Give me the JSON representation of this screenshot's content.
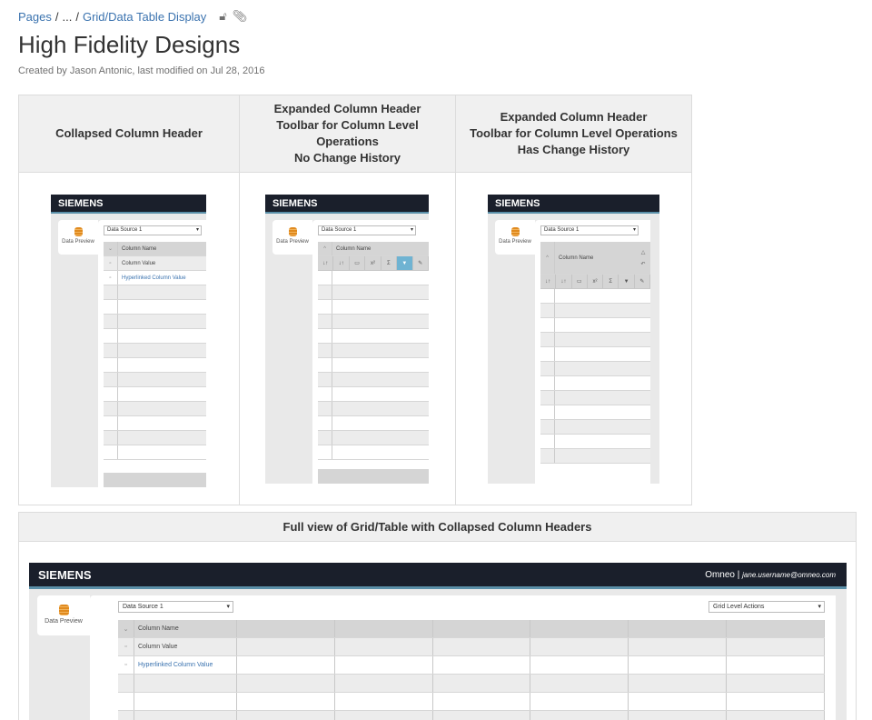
{
  "breadcrumb": {
    "pages": "Pages",
    "sep1": "/",
    "ellipsis": "...",
    "sep2": "/",
    "current": "Grid/Data Table Display"
  },
  "title": "High Fidelity Designs",
  "byline": "Created by Jason Antonic, last modified on Jul 28, 2016",
  "comparison": {
    "headers": [
      "Collapsed Column Header",
      "Expanded Column Header\nToolbar for Column Level Operations\nNo Change History",
      "Expanded Column Header\nToolbar for Column Level Operations\nHas Change History"
    ]
  },
  "mock": {
    "brand": "SIEMENS",
    "tab_label": "Data Preview",
    "data_source": "Data Source 1",
    "column_name": "Column Name",
    "column_value": "Column Value",
    "link_value": "Hyperlinked Column Value",
    "toolbar": [
      "↓↑",
      "↓↑",
      "▭",
      "x²",
      "Σ",
      "▼",
      "✎"
    ],
    "history_icons": [
      "△",
      "↶"
    ]
  },
  "full_view": {
    "heading": "Full view of Grid/Table with Collapsed Column Headers",
    "brand": "SIEMENS",
    "app": "Omneo",
    "user": "jane.username@omneo.com",
    "tab_label": "Data Preview",
    "data_source": "Data Source 1",
    "grid_actions": "Grid Level Actions",
    "column_name": "Column Name",
    "column_value": "Column Value",
    "link_value": "Hyperlinked Column Value"
  }
}
